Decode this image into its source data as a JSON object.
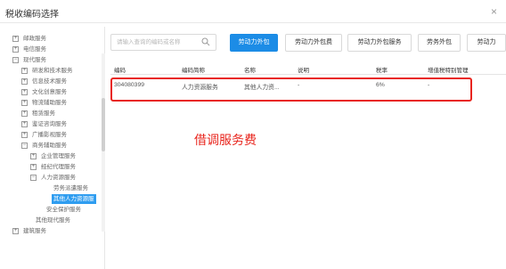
{
  "dialog": {
    "title": "税收编码选择",
    "close_glyph": "×"
  },
  "sidebar": {
    "items": [
      {
        "label": "邮政服务",
        "toggle": "⊞"
      },
      {
        "label": "电信服务",
        "toggle": "⊞"
      },
      {
        "label": "现代服务",
        "toggle": "⊟"
      },
      {
        "label": "研发和技术服务",
        "toggle": "⊞"
      },
      {
        "label": "信息技术服务",
        "toggle": "⊞"
      },
      {
        "label": "文化创意服务",
        "toggle": "⊞"
      },
      {
        "label": "物流辅助服务",
        "toggle": "⊞"
      },
      {
        "label": "租赁服务",
        "toggle": "⊞"
      },
      {
        "label": "鉴证咨询服务",
        "toggle": "⊞"
      },
      {
        "label": "广播影视服务",
        "toggle": "⊞"
      },
      {
        "label": "商务辅助服务",
        "toggle": "⊟"
      },
      {
        "label": "企业管理服务",
        "toggle": "⊞"
      },
      {
        "label": "经纪代理服务",
        "toggle": "⊞"
      },
      {
        "label": "人力资源服务",
        "toggle": "⊟"
      },
      {
        "label": "劳务派遣服务",
        "toggle": ""
      },
      {
        "label": "其他人力资源服",
        "toggle": ""
      },
      {
        "label": "安全保护服务",
        "toggle": ""
      },
      {
        "label": "其他现代服务",
        "toggle": ""
      },
      {
        "label": "建筑服务",
        "toggle": "⊞"
      }
    ]
  },
  "search": {
    "placeholder": "请输入查询的编码或名称"
  },
  "filters": [
    "劳动力外包",
    "劳动力外包费",
    "劳动力外包服务",
    "劳务外包",
    "劳动力"
  ],
  "table": {
    "headers": [
      "编码",
      "编码简称",
      "名称",
      "说明",
      "税率",
      "增值税特别管理"
    ],
    "rows": [
      [
        "304080399",
        "人力资源服务",
        "其他人力资...",
        "-",
        "6%",
        "-"
      ]
    ]
  },
  "annotation": {
    "text": "借调服务费"
  },
  "colors": {
    "accent": "#1c8ce6",
    "highlight": "#e8241c",
    "selected": "#2f9df0"
  }
}
